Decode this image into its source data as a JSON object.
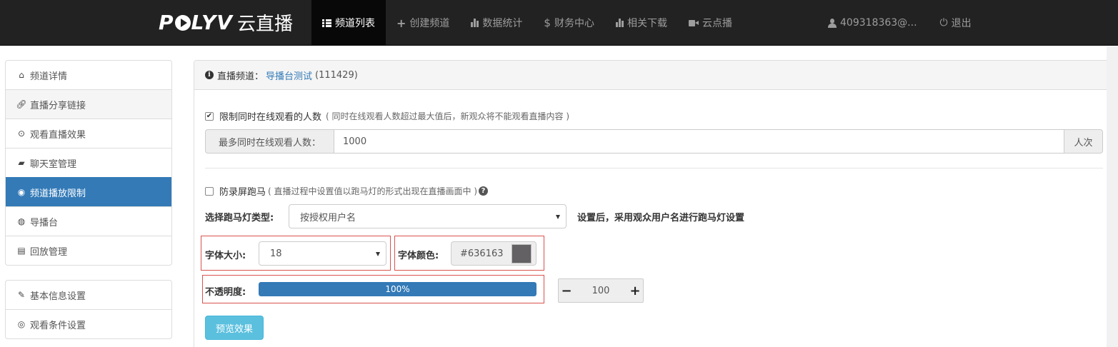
{
  "brand": {
    "logo_prefix": "P",
    "logo_suffix": "LYV",
    "logo_cn": "云直播"
  },
  "nav": {
    "items": [
      {
        "label": "频道列表",
        "icon": "list-icon"
      },
      {
        "label": "创建频道",
        "icon": "plus-icon"
      },
      {
        "label": "数据统计",
        "icon": "bar-chart-icon"
      },
      {
        "label": "财务中心",
        "icon": "dollar-icon"
      },
      {
        "label": "相关下载",
        "icon": "bar-chart-icon"
      },
      {
        "label": "云点播",
        "icon": "video-camera-icon"
      }
    ],
    "user": "409318363@...",
    "logout": "退出",
    "dollar_glyph": "$"
  },
  "sidebar": {
    "group1": [
      {
        "label": "频道详情",
        "icon": "home-icon"
      },
      {
        "label": "直播分享链接",
        "icon": "link-icon"
      },
      {
        "label": "观看直播效果",
        "icon": "play-circle-icon"
      },
      {
        "label": "聊天室管理",
        "icon": "comment-icon"
      },
      {
        "label": "频道播放限制",
        "icon": "eye-slash-icon"
      },
      {
        "label": "导播台",
        "icon": "globe-icon"
      },
      {
        "label": "回放管理",
        "icon": "film-icon"
      }
    ],
    "group2": [
      {
        "label": "基本信息设置",
        "icon": "pencil-icon"
      },
      {
        "label": "观看条件设置",
        "icon": "eye-icon"
      }
    ]
  },
  "panel": {
    "heading_prefix": "直播频道：",
    "channel_name": "导播台测试",
    "channel_id": "(111429)"
  },
  "limit": {
    "checked": true,
    "label": "限制同时在线观看的人数",
    "hint": "( 同时在线观看人数超过最大值后，新观众将不能观看直播内容 )",
    "max_label": "最多同时在线观看人数：",
    "max_value": "1000",
    "unit": "人次"
  },
  "marquee": {
    "checked": false,
    "label": "防录屏跑马",
    "hint": "( 直播过程中设置值以跑马灯的形式出现在直播画面中 )",
    "type_label": "选择跑马灯类型:",
    "type_value": "按授权用户名",
    "type_note": "设置后，采用观众用户名进行跑马灯设置",
    "font_size_label": "字体大小:",
    "font_size_value": "18",
    "font_color_label": "字体颜色:",
    "font_color_value": "#636163",
    "swatch_color": "#636163",
    "opacity_label": "不透明度:",
    "opacity_percent_text": "100%",
    "opacity_value": "100",
    "opacity_fill_fraction": 1.0,
    "minus": "−",
    "plus": "+"
  },
  "preview_button": "预览效果",
  "colors": {
    "primary": "#337ab7",
    "info": "#5bc0de",
    "nav_bg": "#222222",
    "highlight_border": "#d9534f"
  }
}
